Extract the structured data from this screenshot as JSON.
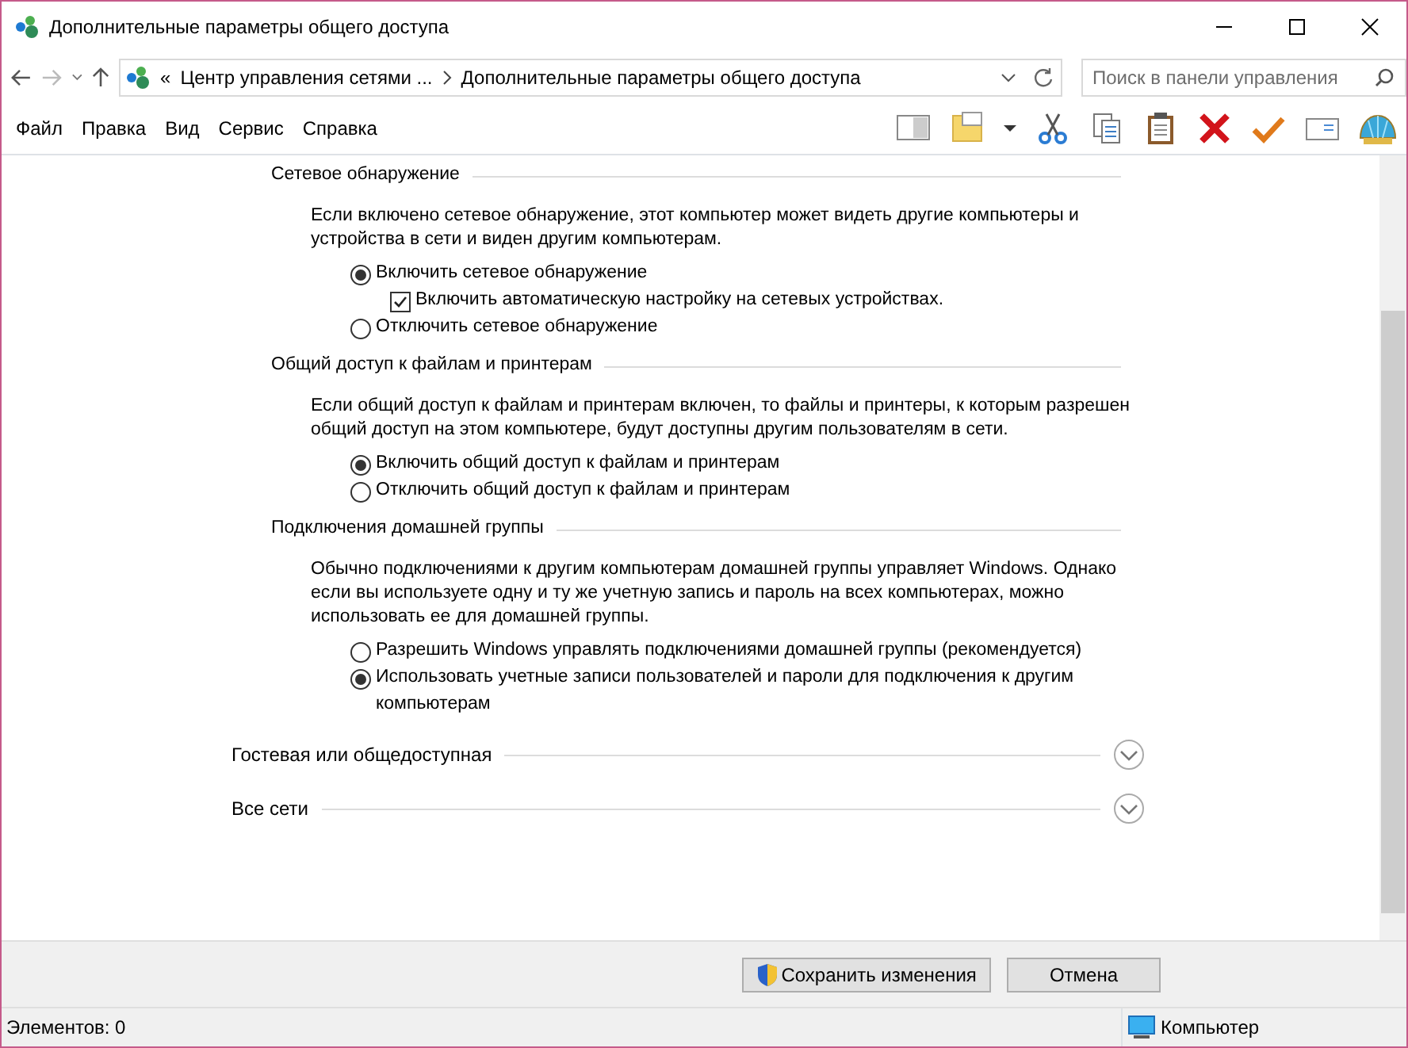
{
  "window": {
    "title": "Дополнительные параметры общего доступа"
  },
  "address_bar": {
    "overflow": "«",
    "breadcrumbs": [
      "Центр управления сетями ...",
      "Дополнительные параметры общего доступа"
    ]
  },
  "search": {
    "placeholder": "Поиск в панели управления"
  },
  "menu": [
    "Файл",
    "Правка",
    "Вид",
    "Сервис",
    "Справка"
  ],
  "sections": [
    {
      "heading": "Сетевое обнаружение",
      "description": "Если включено сетевое обнаружение, этот компьютер может видеть другие компьютеры и устройства в сети и виден другим компьютерам.",
      "options": [
        {
          "kind": "radio",
          "label": "Включить сетевое обнаружение",
          "selected": true
        },
        {
          "kind": "checkbox",
          "label": "Включить автоматическую настройку на сетевых устройствах.",
          "checked": true
        },
        {
          "kind": "radio",
          "label": "Отключить сетевое обнаружение",
          "selected": false
        }
      ]
    },
    {
      "heading": "Общий доступ к файлам и принтерам",
      "description": "Если общий доступ к файлам и принтерам включен, то файлы и принтеры, к которым разрешен общий доступ на этом компьютере, будут доступны другим пользователям в сети.",
      "options": [
        {
          "kind": "radio",
          "label": "Включить общий доступ к файлам и принтерам",
          "selected": true
        },
        {
          "kind": "radio",
          "label": "Отключить общий доступ к файлам и принтерам",
          "selected": false
        }
      ]
    },
    {
      "heading": "Подключения домашней группы",
      "description": "Обычно подключениями к другим компьютерам домашней группы управляет Windows. Однако если вы используете одну и ту же учетную запись и пароль на всех компьютерах, можно использовать ее для домашней группы.",
      "options": [
        {
          "kind": "radio",
          "label": "Разрешить Windows управлять подключениями домашней группы (рекомендуется)",
          "selected": false
        },
        {
          "kind": "radio",
          "label": "Использовать учетные записи пользователей и пароли для подключения к другим компьютерам",
          "selected": true
        }
      ]
    }
  ],
  "profiles": [
    {
      "label": "Гостевая или общедоступная",
      "expanded": false
    },
    {
      "label": "Все сети",
      "expanded": false
    }
  ],
  "buttons": [
    {
      "label": "Сохранить изменения",
      "kind": "shield"
    },
    {
      "label": "Отмена",
      "kind": "plain"
    }
  ],
  "status_bar": {
    "count": "Элементов: 0",
    "zone": "Компьютер"
  }
}
